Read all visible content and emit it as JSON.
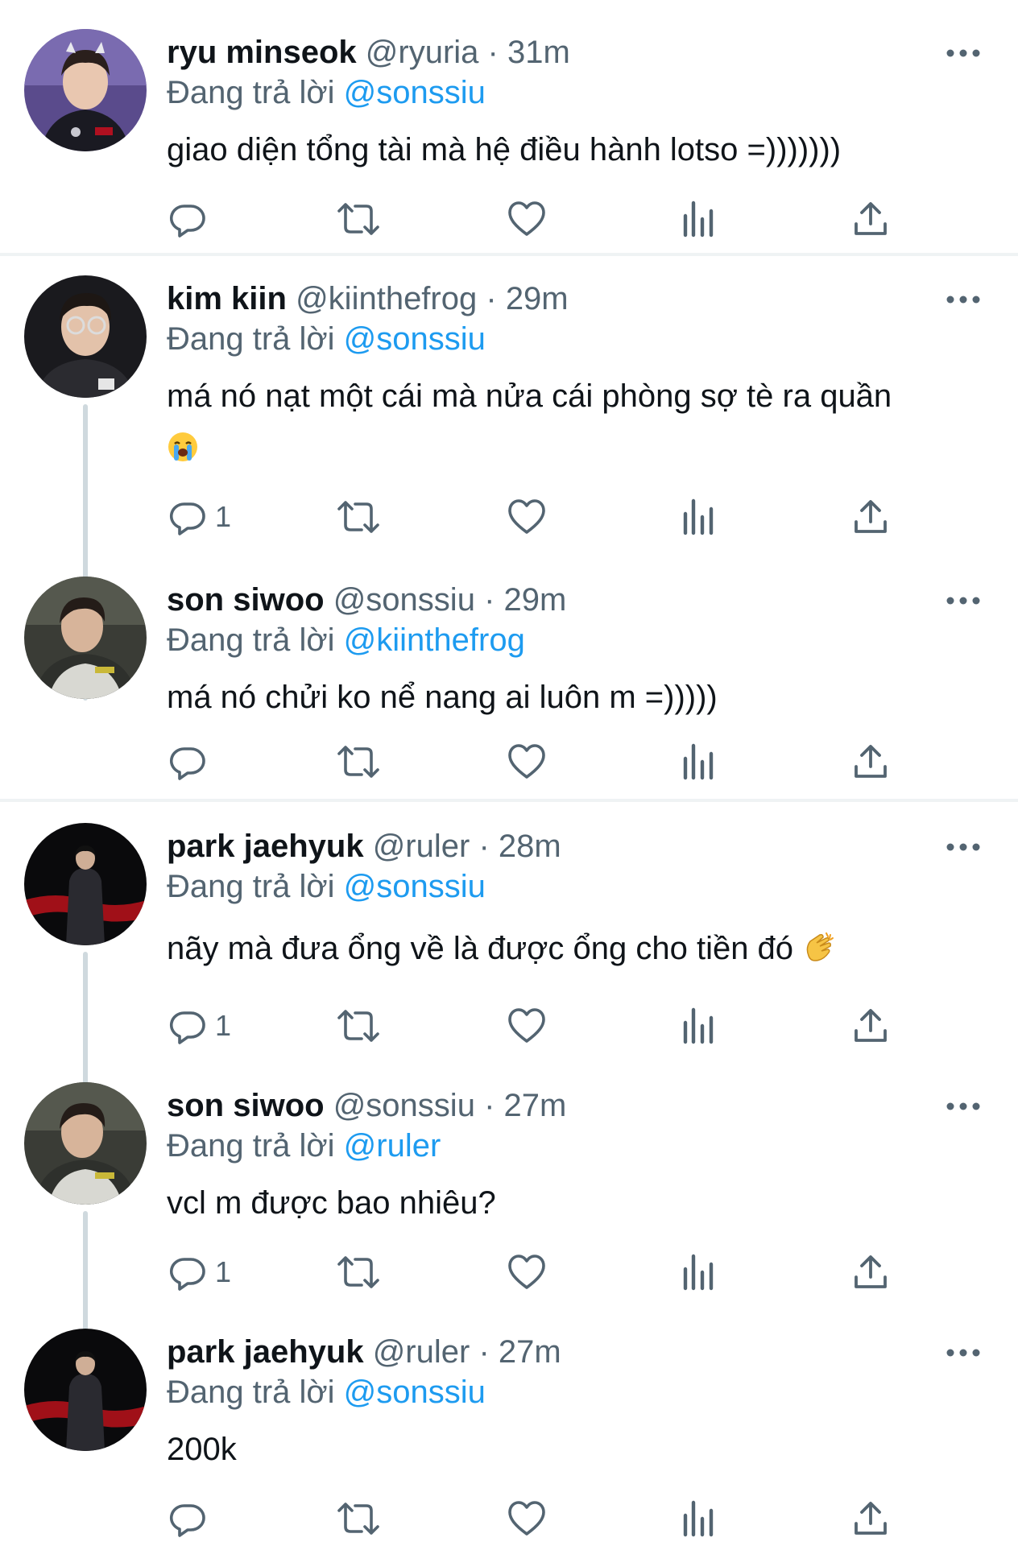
{
  "reply_prefix": "Đang trả lời",
  "separator": "·",
  "colors": {
    "link": "#1d9bf0",
    "secondary_text": "#536471",
    "primary_text": "#0f1419",
    "thread_line": "#cfd9de",
    "divider": "#eff3f4"
  },
  "action_icons": [
    "reply-icon",
    "retweet-icon",
    "like-icon",
    "views-icon",
    "share-icon"
  ],
  "tweets": [
    {
      "name": "ryu minseok",
      "handle": "@ryuria",
      "time": "31m",
      "reply_to": "@sonssiu",
      "text": "giao diện tổng tài mà hệ điều hành lotso =)))))))",
      "emoji": "",
      "reply_count": ""
    },
    {
      "name": "kim kiin",
      "handle": "@kiinthefrog",
      "time": "29m",
      "reply_to": "@sonssiu",
      "text": "má nó nạt một cái mà nửa cái phòng sợ tè ra quần",
      "emoji": "loudly-crying-face",
      "reply_count": "1"
    },
    {
      "name": "son siwoo",
      "handle": "@sonssiu",
      "time": "29m",
      "reply_to": "@kiinthefrog",
      "text": "má nó chửi ko nể nang ai luôn m =)))))",
      "emoji": "",
      "reply_count": ""
    },
    {
      "name": "park jaehyuk",
      "handle": "@ruler",
      "time": "28m",
      "reply_to": "@sonssiu",
      "text": "nãy mà đưa ổng về là được ổng cho tiền đó",
      "emoji": "clapping-hands",
      "reply_count": "1"
    },
    {
      "name": "son siwoo",
      "handle": "@sonssiu",
      "time": "27m",
      "reply_to": "@ruler",
      "text": "vcl m được bao nhiêu?",
      "emoji": "",
      "reply_count": "1"
    },
    {
      "name": "park jaehyuk",
      "handle": "@ruler",
      "time": "27m",
      "reply_to": "@sonssiu",
      "text": "200k",
      "emoji": "",
      "reply_count": ""
    }
  ]
}
